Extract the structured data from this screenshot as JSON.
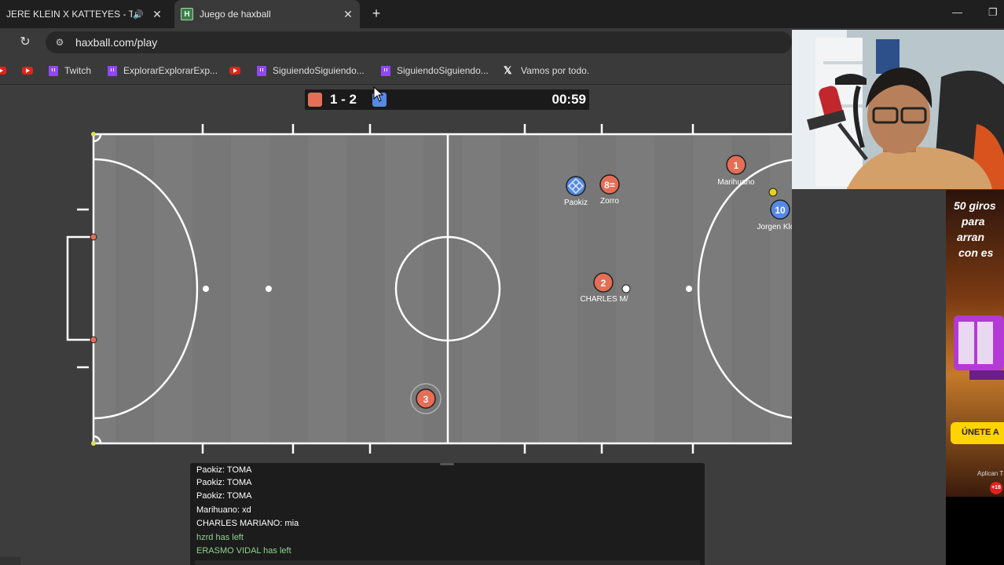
{
  "browser": {
    "tabs": [
      {
        "title": "JERE KLEIN X KATTEYES - TC",
        "active": false
      },
      {
        "title": "Juego de haxball",
        "active": true,
        "favicon": "H"
      }
    ],
    "url": "haxball.com/play",
    "bookmarks": [
      {
        "icon": "youtube-icon",
        "label": ""
      },
      {
        "icon": "youtube-icon",
        "label": ""
      },
      {
        "icon": "twitch-icon",
        "label": "Twitch"
      },
      {
        "icon": "twitch-icon",
        "label": "ExplorarExplorarExp..."
      },
      {
        "icon": "youtube-icon",
        "label": ""
      },
      {
        "icon": "twitch-icon",
        "label": "SiguiendoSiguiendo..."
      },
      {
        "icon": "twitch-icon",
        "label": "SiguiendoSiguiendo..."
      },
      {
        "icon": "x-icon",
        "label": "Vamos por todo."
      }
    ]
  },
  "game": {
    "score": "1 - 2",
    "timer": "00:59",
    "colors": {
      "red": "#e56e56",
      "blue": "#5689e5",
      "field": "#7a7a7a",
      "ball": "#ffffff"
    },
    "players": [
      {
        "number": "1",
        "name": "Marihuano",
        "team": "red"
      },
      {
        "number": "8=",
        "name": "Zorro",
        "team": "red"
      },
      {
        "number": "",
        "name": "Paokiz",
        "team": "blue"
      },
      {
        "number": "10",
        "name": "Jorgen Klopp",
        "team": "blue"
      },
      {
        "number": "2",
        "name": "CHARLES M/",
        "team": "red"
      },
      {
        "number": "3",
        "name": "",
        "team": "red"
      }
    ]
  },
  "chat": {
    "lines": [
      {
        "text": "Paokiz: TOMA",
        "type": "msg"
      },
      {
        "text": "Paokiz: TOMA",
        "type": "msg"
      },
      {
        "text": "Paokiz: TOMA",
        "type": "msg"
      },
      {
        "text": "Marihuano: xd",
        "type": "msg"
      },
      {
        "text": "CHARLES MARIANO: mia",
        "type": "msg"
      },
      {
        "text": "hzrd has left",
        "type": "system"
      },
      {
        "text": "ERASMO VIDAL has left",
        "type": "system"
      }
    ]
  },
  "ad": {
    "lines": [
      "50 giros",
      "para",
      "arran",
      "con es"
    ],
    "cta": "ÚNETE A",
    "small": "Aplican T",
    "badge": "+18"
  }
}
